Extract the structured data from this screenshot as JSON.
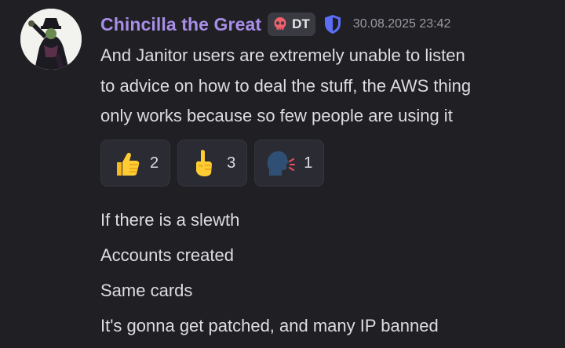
{
  "author": {
    "name": "Chincilla the Great",
    "tag": "DT",
    "tag_icon": "skull-icon",
    "badge_icon": "shield-icon",
    "timestamp": "30.08.2025 23:42",
    "name_color": "#a98ee8"
  },
  "message": {
    "lines": [
      "And Janitor users are extremely unable to listen",
      "to advice on how to deal the stuff, the AWS thing",
      "only works because so few people are using it"
    ]
  },
  "reactions": [
    {
      "emoji": "thumbs-up-icon",
      "count": "2"
    },
    {
      "emoji": "index-pointing-up-icon",
      "count": "3"
    },
    {
      "emoji": "speaking-head-icon",
      "count": "1"
    }
  ],
  "followups": [
    "If there is a slewth",
    "Accounts created",
    "Same cards",
    "It's gonna get patched, and many IP banned"
  ]
}
